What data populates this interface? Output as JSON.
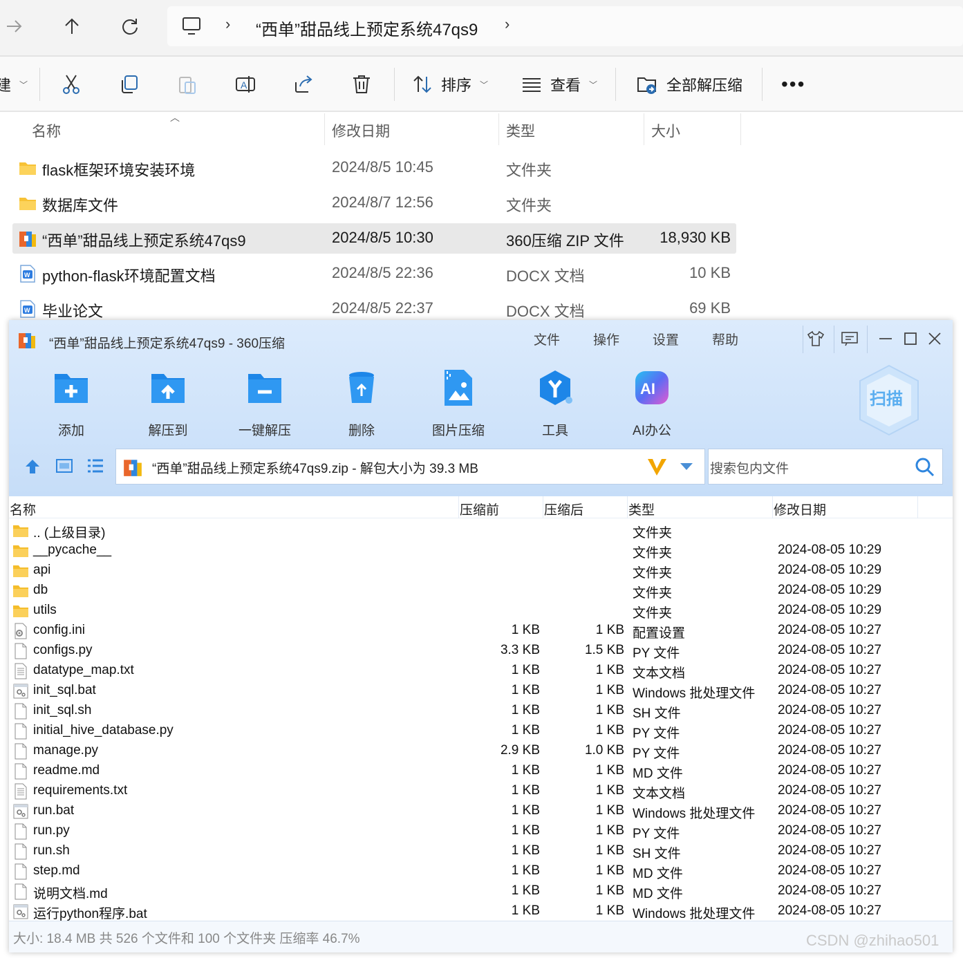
{
  "explorer": {
    "breadcrumb": "“西单”甜品线上预定系统47qs9",
    "toolbar": {
      "new_label": "建",
      "sort_label": "排序",
      "view_label": "查看",
      "extract_all_label": "全部解压缩"
    },
    "columns": {
      "name": "名称",
      "date": "修改日期",
      "type": "类型",
      "size": "大小"
    },
    "rows": [
      {
        "name": "flask框架环境安装环境",
        "date": "2024/8/5 10:45",
        "type": "文件夹",
        "size": ""
      },
      {
        "name": "数据库文件",
        "date": "2024/8/7 12:56",
        "type": "文件夹",
        "size": ""
      },
      {
        "name": "“西单”甜品线上预定系统47qs9",
        "date": "2024/8/5 10:30",
        "type": "360压缩 ZIP 文件",
        "size": "18,930 KB"
      },
      {
        "name": "python-flask环境配置文档",
        "date": "2024/8/5 22:36",
        "type": "DOCX 文档",
        "size": "10 KB"
      },
      {
        "name": "毕业论文",
        "date": "2024/8/5 22:37",
        "type": "DOCX 文档",
        "size": "69 KB"
      }
    ]
  },
  "zip": {
    "title": "“西单”甜品线上预定系统47qs9 - 360压缩",
    "menu": [
      "文件",
      "操作",
      "设置",
      "帮助"
    ],
    "tools": [
      "添加",
      "解压到",
      "一键解压",
      "删除",
      "图片压缩",
      "工具",
      "AI办公"
    ],
    "scan_label": "扫描",
    "ai_badge": "AI",
    "address": "“西单”甜品线上预定系统47qs9.zip - 解包大小为 39.3 MB",
    "search_placeholder": "搜索包内文件",
    "columns": {
      "name": "名称",
      "before": "压缩前",
      "after": "压缩后",
      "type": "类型",
      "date": "修改日期"
    },
    "rows": [
      {
        "name": ".. (上级目录)",
        "before": "",
        "after": "",
        "type": "文件夹",
        "date": "",
        "kind": "folder"
      },
      {
        "name": "__pycache__",
        "before": "",
        "after": "",
        "type": "文件夹",
        "date": "2024-08-05 10:29",
        "kind": "folder"
      },
      {
        "name": "api",
        "before": "",
        "after": "",
        "type": "文件夹",
        "date": "2024-08-05 10:29",
        "kind": "folder"
      },
      {
        "name": "db",
        "before": "",
        "after": "",
        "type": "文件夹",
        "date": "2024-08-05 10:29",
        "kind": "folder"
      },
      {
        "name": "utils",
        "before": "",
        "after": "",
        "type": "文件夹",
        "date": "2024-08-05 10:29",
        "kind": "folder"
      },
      {
        "name": "config.ini",
        "before": "1 KB",
        "after": "1 KB",
        "type": "配置设置",
        "date": "2024-08-05 10:27",
        "kind": "gear"
      },
      {
        "name": "configs.py",
        "before": "3.3 KB",
        "after": "1.5 KB",
        "type": "PY 文件",
        "date": "2024-08-05 10:27",
        "kind": "file"
      },
      {
        "name": "datatype_map.txt",
        "before": "1 KB",
        "after": "1 KB",
        "type": "文本文档",
        "date": "2024-08-05 10:27",
        "kind": "text"
      },
      {
        "name": "init_sql.bat",
        "before": "1 KB",
        "after": "1 KB",
        "type": "Windows 批处理文件",
        "date": "2024-08-05 10:27",
        "kind": "bat"
      },
      {
        "name": "init_sql.sh",
        "before": "1 KB",
        "after": "1 KB",
        "type": "SH 文件",
        "date": "2024-08-05 10:27",
        "kind": "file"
      },
      {
        "name": "initial_hive_database.py",
        "before": "1 KB",
        "after": "1 KB",
        "type": "PY 文件",
        "date": "2024-08-05 10:27",
        "kind": "file"
      },
      {
        "name": "manage.py",
        "before": "2.9 KB",
        "after": "1.0 KB",
        "type": "PY 文件",
        "date": "2024-08-05 10:27",
        "kind": "file"
      },
      {
        "name": "readme.md",
        "before": "1 KB",
        "after": "1 KB",
        "type": "MD 文件",
        "date": "2024-08-05 10:27",
        "kind": "file"
      },
      {
        "name": "requirements.txt",
        "before": "1 KB",
        "after": "1 KB",
        "type": "文本文档",
        "date": "2024-08-05 10:27",
        "kind": "text"
      },
      {
        "name": "run.bat",
        "before": "1 KB",
        "after": "1 KB",
        "type": "Windows 批处理文件",
        "date": "2024-08-05 10:27",
        "kind": "bat"
      },
      {
        "name": "run.py",
        "before": "1 KB",
        "after": "1 KB",
        "type": "PY 文件",
        "date": "2024-08-05 10:27",
        "kind": "file"
      },
      {
        "name": "run.sh",
        "before": "1 KB",
        "after": "1 KB",
        "type": "SH 文件",
        "date": "2024-08-05 10:27",
        "kind": "file"
      },
      {
        "name": "step.md",
        "before": "1 KB",
        "after": "1 KB",
        "type": "MD 文件",
        "date": "2024-08-05 10:27",
        "kind": "file"
      },
      {
        "name": "说明文档.md",
        "before": "1 KB",
        "after": "1 KB",
        "type": "MD 文件",
        "date": "2024-08-05 10:27",
        "kind": "file"
      },
      {
        "name": "运行python程序.bat",
        "before": "1 KB",
        "after": "1 KB",
        "type": "Windows 批处理文件",
        "date": "2024-08-05 10:27",
        "kind": "bat"
      }
    ],
    "status": "大小: 18.4 MB 共 526 个文件和 100 个文件夹 压缩率 46.7%"
  },
  "watermark": "CSDN @zhihao501",
  "colors": {
    "accent": "#1a7fe0",
    "folder": "#f7c236",
    "zip_bg": "#d7e8fb"
  }
}
